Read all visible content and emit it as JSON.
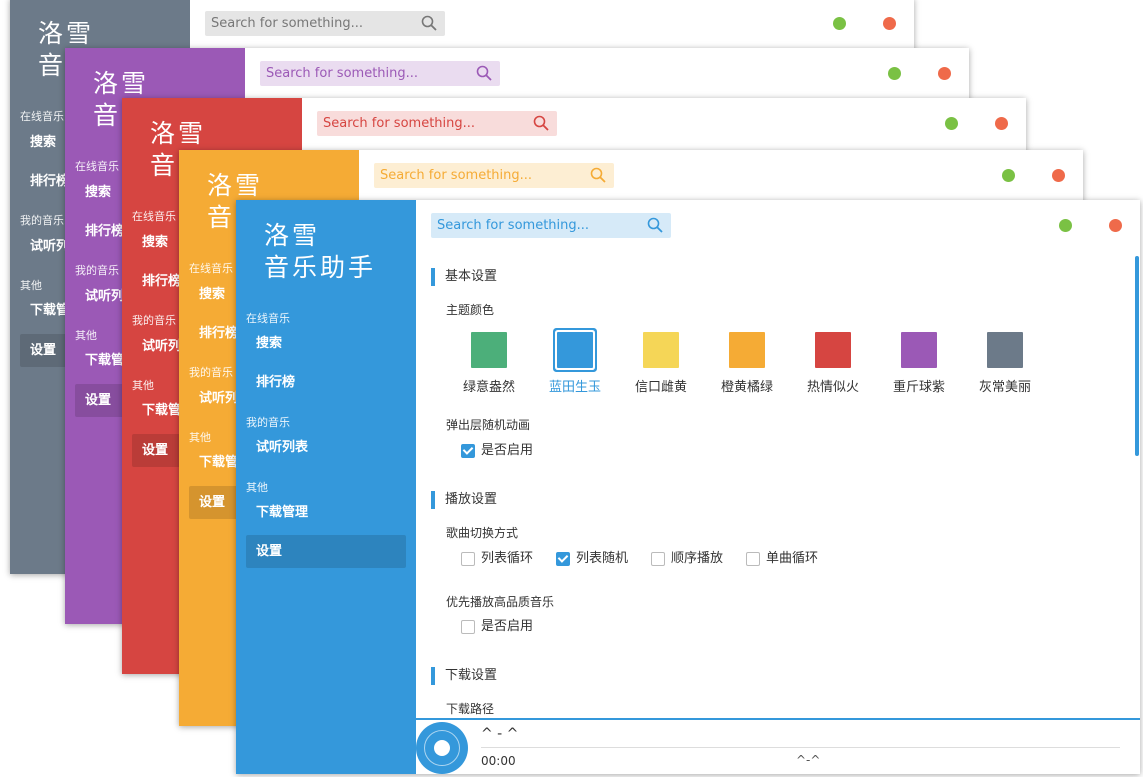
{
  "app": {
    "logo_line1": "洛雪",
    "logo_line2": "音乐助手",
    "logo_line2_short": "音"
  },
  "search": {
    "placeholder": "Search for something..."
  },
  "sidebar": {
    "online_label": "在线音乐",
    "search": "搜索",
    "charts": "排行榜",
    "charts_short": "排行榜",
    "my_label": "我的音乐",
    "playlist": "试听列表",
    "playlist_short": "试听列",
    "other_label": "其他",
    "download": "下载管理",
    "download_short": "下载管",
    "settings": "设置"
  },
  "back_windows": [
    {
      "id": "gray",
      "color": "#6c7a89",
      "search_bg": "#e5e5e5",
      "search_color": "#777777"
    },
    {
      "id": "purple",
      "color": "#9b59b6",
      "search_bg": "#eadcf0",
      "search_color": "#9b59b6"
    },
    {
      "id": "red",
      "color": "#d64541",
      "search_bg": "#f8dcdb",
      "search_color": "#d64541"
    },
    {
      "id": "orange",
      "color": "#f5ab35",
      "search_bg": "#fdeed3",
      "search_color": "#f5ab35"
    }
  ],
  "settings": {
    "basic_title": "基本设置",
    "theme_label": "主题颜色",
    "themes": [
      {
        "name": "绿意盎然",
        "color": "#4caf7a"
      },
      {
        "name": "蓝田生玉",
        "color": "#3498db",
        "selected": true
      },
      {
        "name": "信口雌黄",
        "color": "#f5d657"
      },
      {
        "name": "橙黄橘绿",
        "color": "#f5ab35"
      },
      {
        "name": "热情似火",
        "color": "#d64541"
      },
      {
        "name": "重斤球紫",
        "color": "#9b59b6"
      },
      {
        "name": "灰常美丽",
        "color": "#6c7a89"
      }
    ],
    "popup_label": "弹出层随机动画",
    "popup_enable": "是否启用",
    "play_title": "播放设置",
    "switch_label": "歌曲切换方式",
    "switch_options": [
      "列表循环",
      "列表随机",
      "顺序播放",
      "单曲循环"
    ],
    "quality_label": "优先播放高品质音乐",
    "quality_enable": "是否启用",
    "download_title": "下载设置",
    "download_path_label": "下载路径"
  },
  "player": {
    "song": "^ - ^",
    "time": "00:00",
    "artist": "^-^"
  }
}
